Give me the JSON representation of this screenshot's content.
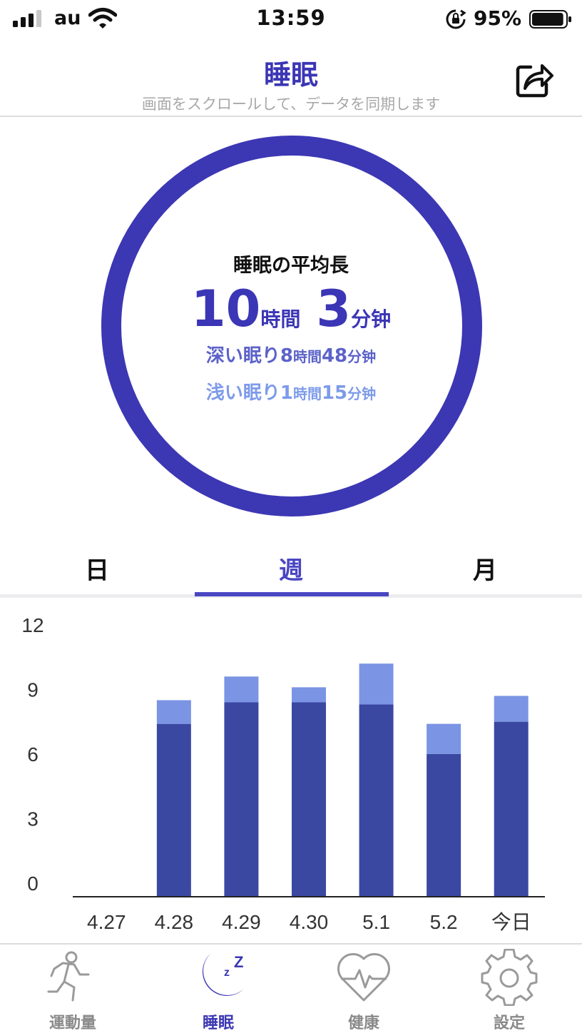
{
  "status_bar": {
    "carrier": "au",
    "time": "13:59",
    "battery": "95%",
    "battery_level": 0.95
  },
  "header": {
    "title": "睡眠",
    "subtitle": "画面をスクロールして、データを同期します"
  },
  "summary": {
    "label": "睡眠の平均長",
    "total_hours": "10",
    "hours_unit": "時間",
    "total_minutes": "3",
    "minutes_unit": "分钟",
    "deep_label": "深い眠り",
    "deep_hours": "8",
    "deep_minutes": "48",
    "light_label": "浅い眠り",
    "light_hours": "1",
    "light_minutes": "15"
  },
  "tabs": [
    {
      "label": "日"
    },
    {
      "label": "週"
    },
    {
      "label": "月"
    }
  ],
  "active_tab": "週",
  "chart_data": {
    "type": "bar",
    "stacked": true,
    "categories": [
      "4.27",
      "4.28",
      "4.29",
      "4.30",
      "5.1",
      "5.2",
      "今日"
    ],
    "series": [
      {
        "values": [
          0,
          8.0,
          9.0,
          9.0,
          8.9,
          6.6,
          8.1
        ],
        "color": "#3a48a2"
      },
      {
        "values": [
          0,
          1.1,
          1.2,
          0.7,
          1.9,
          1.4,
          1.2
        ],
        "color": "#7b94e4"
      }
    ],
    "yticks": [
      0,
      3,
      6,
      9,
      12
    ],
    "ylim": [
      0,
      12
    ]
  },
  "tabbar": {
    "items": [
      {
        "label": "運動量",
        "icon": "running-icon"
      },
      {
        "label": "睡眠",
        "icon": "moon-sleep-icon"
      },
      {
        "label": "健康",
        "icon": "heart-pulse-icon"
      },
      {
        "label": "設定",
        "icon": "gear-icon"
      }
    ],
    "active": "睡眠"
  },
  "colors": {
    "accent": "#3c37b3",
    "deep": "#3a48a2",
    "light": "#7b94e4",
    "subtitle": "#a8a8a8"
  }
}
